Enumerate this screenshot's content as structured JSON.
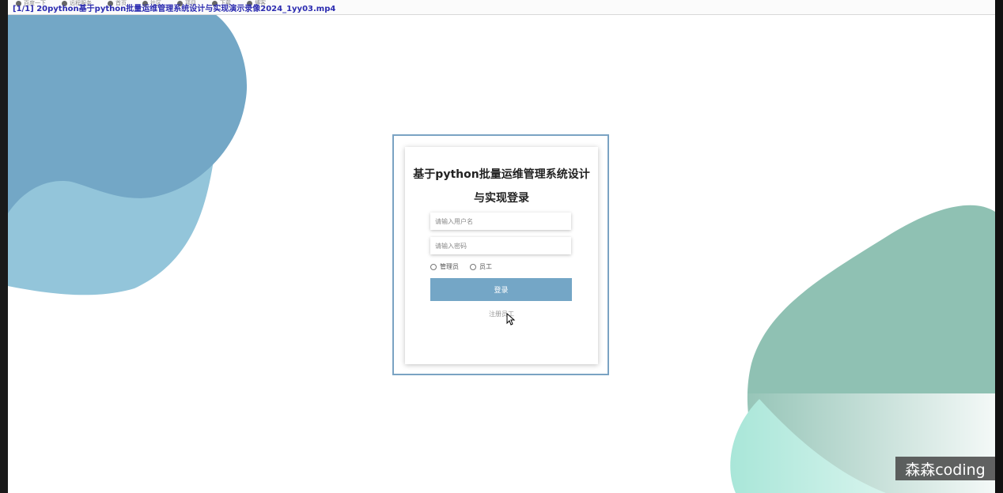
{
  "browser": {
    "video_title": "[1/1] 20python基于python批量运维管理系统设计与实现演示录像2024_1yy03.mp4",
    "bookmarks": [
      {
        "label": "百度一下",
        "icon": "globe-icon"
      },
      {
        "label": "远程服务",
        "icon": "globe-icon"
      },
      {
        "label": "首页",
        "icon": "globe-icon"
      },
      {
        "label": "社区",
        "icon": "globe-icon"
      },
      {
        "label": "项目",
        "icon": "globe-icon"
      },
      {
        "label": "下载",
        "icon": "globe-icon"
      },
      {
        "label": "博客",
        "icon": "globe-icon"
      }
    ]
  },
  "login": {
    "title": "基于python批量运维管理系统设计与实现登录",
    "username_placeholder": "请输入用户名",
    "password_placeholder": "请输入密码",
    "roles": [
      "管理员",
      "员工"
    ],
    "login_label": "登录",
    "register_label": "注册员工"
  },
  "watermark": "森森coding",
  "colors": {
    "accent": "#74a6c6",
    "blob_dark_blue": "#73a7c6",
    "blob_light_blue": "#93c5da",
    "blob_green": "#8fc1b3",
    "blob_mint": "#a8e6d8"
  }
}
